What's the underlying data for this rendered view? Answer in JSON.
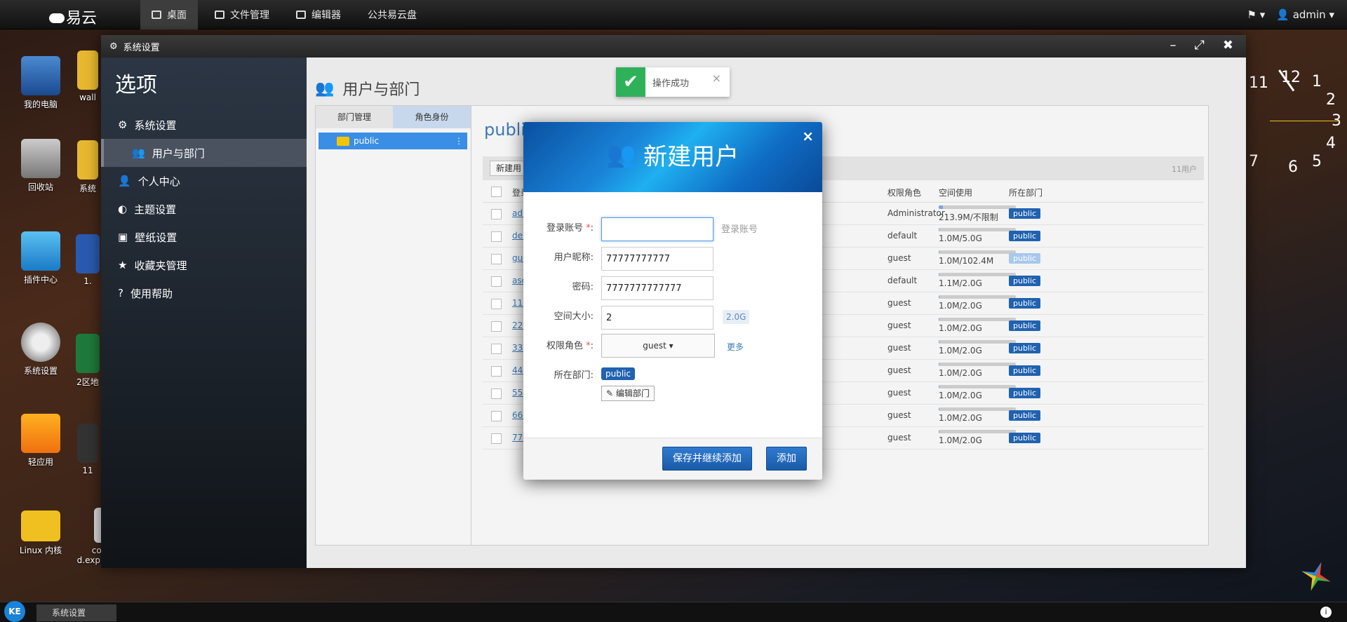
{
  "topbar": {
    "logo": "易云",
    "nav": [
      {
        "label": "桌面",
        "active": true
      },
      {
        "label": "文件管理"
      },
      {
        "label": "编辑器"
      },
      {
        "label": "公共易云盘"
      }
    ],
    "user": "admin"
  },
  "desktop": {
    "icons": [
      {
        "label": "我的电脑"
      },
      {
        "label": "wall"
      },
      {
        "label": "回收站"
      },
      {
        "label": "系统"
      },
      {
        "label": "插件中心"
      },
      {
        "label": "1."
      },
      {
        "label": "系统设置"
      },
      {
        "label": "2区地"
      },
      {
        "label": "轻应用"
      },
      {
        "label": "11"
      },
      {
        "label": "Linux 内核"
      },
      {
        "label": "com.k d.explorer.ap"
      }
    ]
  },
  "window": {
    "title": "系统设置",
    "sidebar_title": "选项",
    "menu": [
      {
        "label": "系统设置"
      },
      {
        "label": "用户与部门",
        "active": true
      },
      {
        "label": "个人中心"
      },
      {
        "label": "主题设置"
      },
      {
        "label": "壁纸设置"
      },
      {
        "label": "收藏夹管理"
      },
      {
        "label": "使用帮助"
      }
    ],
    "main_title": "用户与部门",
    "tabs": {
      "dept": "部门管理",
      "role": "角色身份"
    },
    "tree_item": "public",
    "right_title": "public",
    "new_button": "新建用",
    "user_count": "11用户",
    "headers": {
      "account": "登录",
      "role": "权限角色",
      "space": "空间使用",
      "dept": "所在部门"
    },
    "rows": [
      {
        "account": "adr",
        "role": "Administrator",
        "space": "213.9M/不限制",
        "fill": 0.05,
        "dept": "public"
      },
      {
        "account": "der",
        "role": "default",
        "space": "1.0M/5.0G",
        "fill": 0.01,
        "dept": "public"
      },
      {
        "account": "gue",
        "role": "guest",
        "space": "1.0M/102.4M",
        "fill": 0.01,
        "dept": "public"
      },
      {
        "account": "asc",
        "role": "default",
        "space": "1.1M/2.0G",
        "fill": 0.01,
        "dept": "public"
      },
      {
        "account": "111",
        "role": "guest",
        "space": "1.0M/2.0G",
        "fill": 0.01,
        "dept": "public"
      },
      {
        "account": "222",
        "role": "guest",
        "space": "1.0M/2.0G",
        "fill": 0.01,
        "dept": "public"
      },
      {
        "account": "333",
        "role": "guest",
        "space": "1.0M/2.0G",
        "fill": 0.01,
        "dept": "public"
      },
      {
        "account": "444",
        "role": "guest",
        "space": "1.0M/2.0G",
        "fill": 0.01,
        "dept": "public"
      },
      {
        "account": "555",
        "role": "guest",
        "space": "1.0M/2.0G",
        "fill": 0.01,
        "dept": "public"
      },
      {
        "account": "666",
        "role": "guest",
        "space": "1.0M/2.0G",
        "fill": 0.01,
        "dept": "public"
      },
      {
        "account": "777",
        "role": "guest",
        "space": "1.0M/2.0G",
        "fill": 0.01,
        "dept": "public"
      }
    ]
  },
  "toast": {
    "text": "操作成功",
    "close": "×"
  },
  "dialog": {
    "title": "新建用户",
    "close": "×",
    "fields": {
      "account_label": "登录账号",
      "account_value": "",
      "account_hint": "登录账号",
      "nick_label": "用户昵称",
      "nick_value": "77777777777",
      "pwd_label": "密码",
      "pwd_value": "7777777777777",
      "size_label": "空间大小",
      "size_value": "2",
      "size_hint": "2.0G",
      "role_label": "权限角色",
      "role_value": "guest",
      "more": "更多",
      "dept_label": "所在部门",
      "dept_value": "public",
      "edit_dept": "编辑部门"
    },
    "buttons": {
      "save_continue": "保存并继续添加",
      "add": "添加"
    }
  },
  "taskbar": {
    "start": "KE",
    "task": "系统设置"
  },
  "clock": {
    "numbers": [
      "12",
      "1",
      "2",
      "3",
      "4",
      "5",
      "6",
      "7",
      "11"
    ]
  }
}
